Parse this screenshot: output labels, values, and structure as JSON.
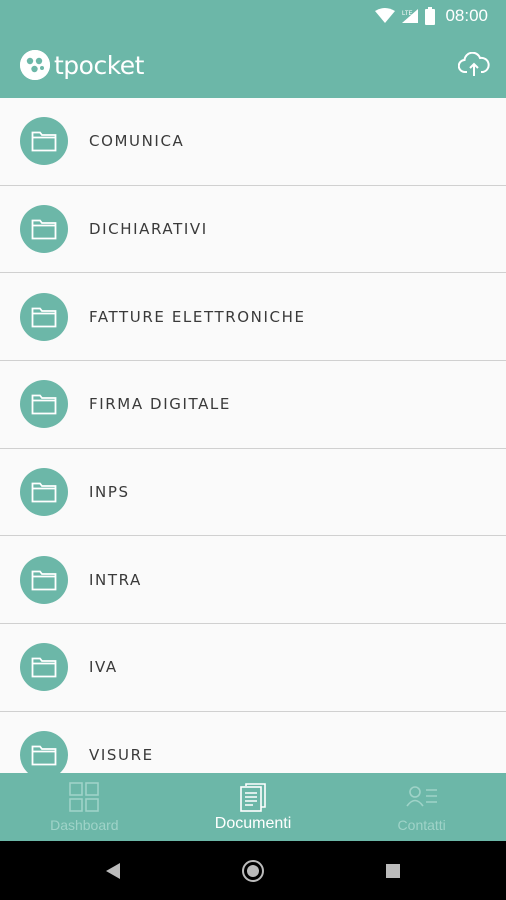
{
  "status_bar": {
    "time": "08:00",
    "network": "LTE",
    "icons": [
      "wifi-icon",
      "signal-icon",
      "battery-icon"
    ]
  },
  "app_bar": {
    "logo_text": "tpocket",
    "action_icon": "cloud-upload-icon"
  },
  "folders": [
    {
      "label": "COMUNICA",
      "icon": "folder-icon"
    },
    {
      "label": "DICHIARATIVI",
      "icon": "folder-icon"
    },
    {
      "label": "FATTURE ELETTRONICHE",
      "icon": "folder-icon"
    },
    {
      "label": "FIRMA DIGITALE",
      "icon": "folder-icon"
    },
    {
      "label": "INPS",
      "icon": "folder-icon"
    },
    {
      "label": "INTRA",
      "icon": "folder-icon"
    },
    {
      "label": "IVA",
      "icon": "folder-icon"
    },
    {
      "label": "VISURE",
      "icon": "folder-icon"
    }
  ],
  "bottom_nav": {
    "items": [
      {
        "label": "Dashboard",
        "icon": "dashboard-grid-icon",
        "active": false
      },
      {
        "label": "Documenti",
        "icon": "documents-icon",
        "active": true
      },
      {
        "label": "Contatti",
        "icon": "contacts-icon",
        "active": false
      }
    ]
  },
  "system_nav": {
    "buttons": [
      "back-icon",
      "home-icon",
      "recents-icon"
    ]
  },
  "colors": {
    "primary": "#6cb7a8",
    "inactive_nav": "#9fd3c8",
    "text": "#3a3a3a",
    "divider": "#d0d0d0"
  }
}
